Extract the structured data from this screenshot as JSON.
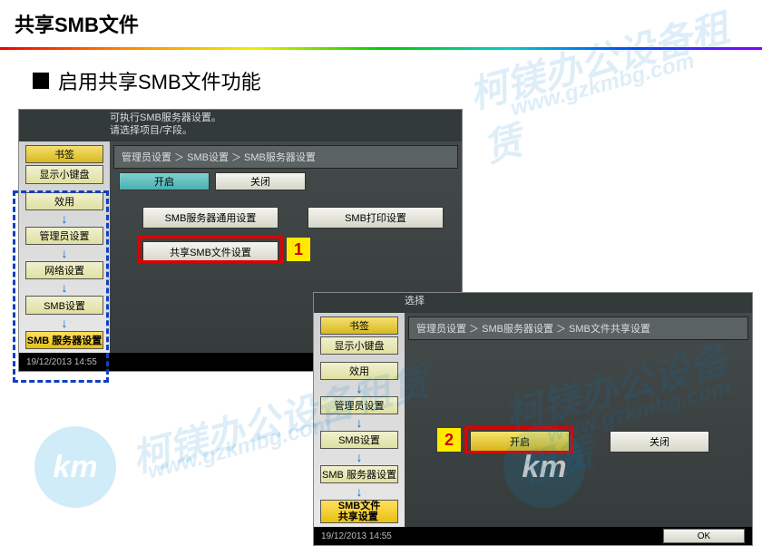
{
  "page": {
    "title": "共享SMB文件",
    "subtitle": "启用共享SMB文件功能"
  },
  "panel1": {
    "head1": "可执行SMB服务器设置。",
    "head2": "请选择项目/字段。",
    "sidebar": {
      "bkmk": "书签",
      "kbd": "显示小键盘",
      "items": [
        "效用",
        "管理员设置",
        "网络设置",
        "SMB设置",
        "SMB 服务器设置"
      ]
    },
    "bc": "管理员设置 ＞ SMB设置 ＞ SMB服务器设置",
    "tabs": {
      "on": "开启",
      "off": "关闭"
    },
    "btns": {
      "common": "SMB服务器通用设置",
      "print": "SMB打印设置",
      "share": "共享SMB文件设置"
    },
    "footer": {
      "ts": "19/12/2013    14:55"
    }
  },
  "panel2": {
    "head": "选择",
    "sidebar": {
      "bkmk": "书签",
      "kbd": "显示小键盘",
      "items": [
        "效用",
        "管理员设置",
        "SMB设置",
        "SMB 服务器设置",
        "SMB文件\n共享设置"
      ]
    },
    "bc": "管理员设置 ＞ SMB服务器设置 ＞ SMB文件共享设置",
    "btns": {
      "on": "开启",
      "off": "关闭"
    },
    "footer": {
      "ts": "19/12/2013    14:55",
      "ok": "OK"
    }
  },
  "annot": {
    "n1": "1",
    "n2": "2"
  },
  "wm": {
    "brand": "km",
    "txt1": "柯镁办公设备租赁",
    "txt2": "www.gzkmbg.com"
  }
}
